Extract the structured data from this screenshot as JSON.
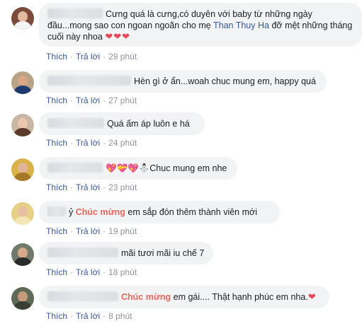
{
  "comments": [
    {
      "text_before": "Cưng quá là cưng,có duyên với baby từ những ngày đầu...mong sao con ngoan ngoãn cho mẹ ",
      "tag": "Than Thuy Ha",
      "text_after": " đỡ mệt những tháng cuối này nhoa",
      "hearts": "❤❤❤",
      "like": "Thích",
      "reply": "Trả lời",
      "time": "29 phút"
    },
    {
      "text": "Hèn gì ở ẩn...woah chuc mung em, happy quá",
      "like": "Thích",
      "reply": "Trả lời",
      "time": "27 phút"
    },
    {
      "text": "Quá ấm áp luôn e há",
      "like": "Thích",
      "reply": "Trả lời",
      "time": "24 phút"
    },
    {
      "emoji": "💖💝💖⛄",
      "text": "Chuc mung em nhe",
      "like": "Thích",
      "reply": "Trả lời",
      "time": "23 phút"
    },
    {
      "prefix": "ỷ",
      "highlight": "Chúc mừng",
      "text": " em sắp đón thêm thành viên mới",
      "like": "Thích",
      "reply": "Trả lời",
      "time": "19 phút"
    },
    {
      "text": "mãi tươi mãi iu chế 7",
      "like": "Thích",
      "reply": "Trả lời",
      "time": "18 phút"
    },
    {
      "highlight": "Chúc mừng",
      "text": " em gái.... Thật hạnh phúc em nha.",
      "hearts": "❤",
      "like": "Thích",
      "reply": "Trả lời",
      "time": "8 phút"
    }
  ],
  "colors": {
    "bubble": "#f2f3f5",
    "link": "#385898",
    "highlight": "#e9665a",
    "heart": "#e8475a",
    "meta": "#90949c"
  }
}
